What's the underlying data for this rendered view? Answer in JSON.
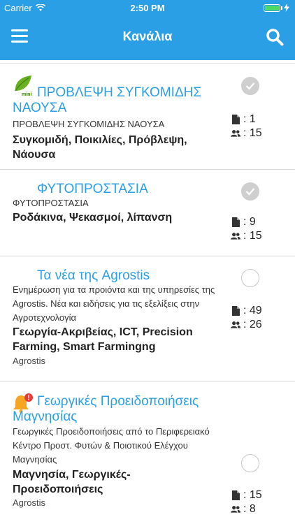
{
  "status_bar": {
    "carrier": "Carrier",
    "time": "2:50 PM"
  },
  "nav": {
    "title": "Κανάλια"
  },
  "channels": [
    {
      "title": "ΠΡΟΒΛΕΨΗ ΣΥΓΚΟΜΙΔΗΣ ΝΑΟΥΣΑ",
      "description": "ΠΡΟΒΛΕΨΗ ΣΥΓΚΟΜΙΔΗΣ ΝΑΟΥΣΑ",
      "tags": "Συγκομιδή, Ποικιλίες, Πρόβλεψη, Νάουσα",
      "author": "",
      "documents": ": 1",
      "members": ": 15",
      "subscribed": true,
      "icon": "leaf-mini-icon",
      "icon_label": "mini"
    },
    {
      "title": "ΦΥΤΟΠΡΟΣΤΑΣΙΑ",
      "description": "ΦΥΤΟΠΡΟΣΤΑΣΙΑ",
      "tags": "Ροδάκινα, Ψεκασμοί, λίπανση",
      "author": "",
      "documents": ": 9",
      "members": ": 15",
      "subscribed": true,
      "icon": ""
    },
    {
      "title": "Τα νέα της Agrostis",
      "description": "Ενημέρωση για τα προιόντα και της υπηρεσίες της Agrostis. Νέα και ειδήσεις για τις εξελίξεις στην Αγροτεχνολογία",
      "tags": "Γεωργία-Ακριβείας, ICT, Precision Farming, Smart Farmingng",
      "author": "Agrostis",
      "documents": ": 49",
      "members": ": 26",
      "subscribed": false,
      "icon": ""
    },
    {
      "title": "Γεωργικές Προειδοποιήσεις Μαγνησίας",
      "description": "Γεωργικές Προειδοποιήσεις από το Περιφερειακό Κέντρο Προστ. Φυτών & Ποιοτικού Ελέγχου Μαγνησίας",
      "tags": "Μαγνησία, Γεωργικές-Προειδοποιήσεις",
      "author": "Agrostis",
      "documents": ": 15",
      "members": ": 8",
      "subscribed": false,
      "icon": "bell-alert-icon",
      "badge": "!"
    }
  ],
  "colors": {
    "primary": "#2a9fe6",
    "battery": "#4cd964",
    "alert": "#e53935",
    "bell": "#f5a623"
  }
}
